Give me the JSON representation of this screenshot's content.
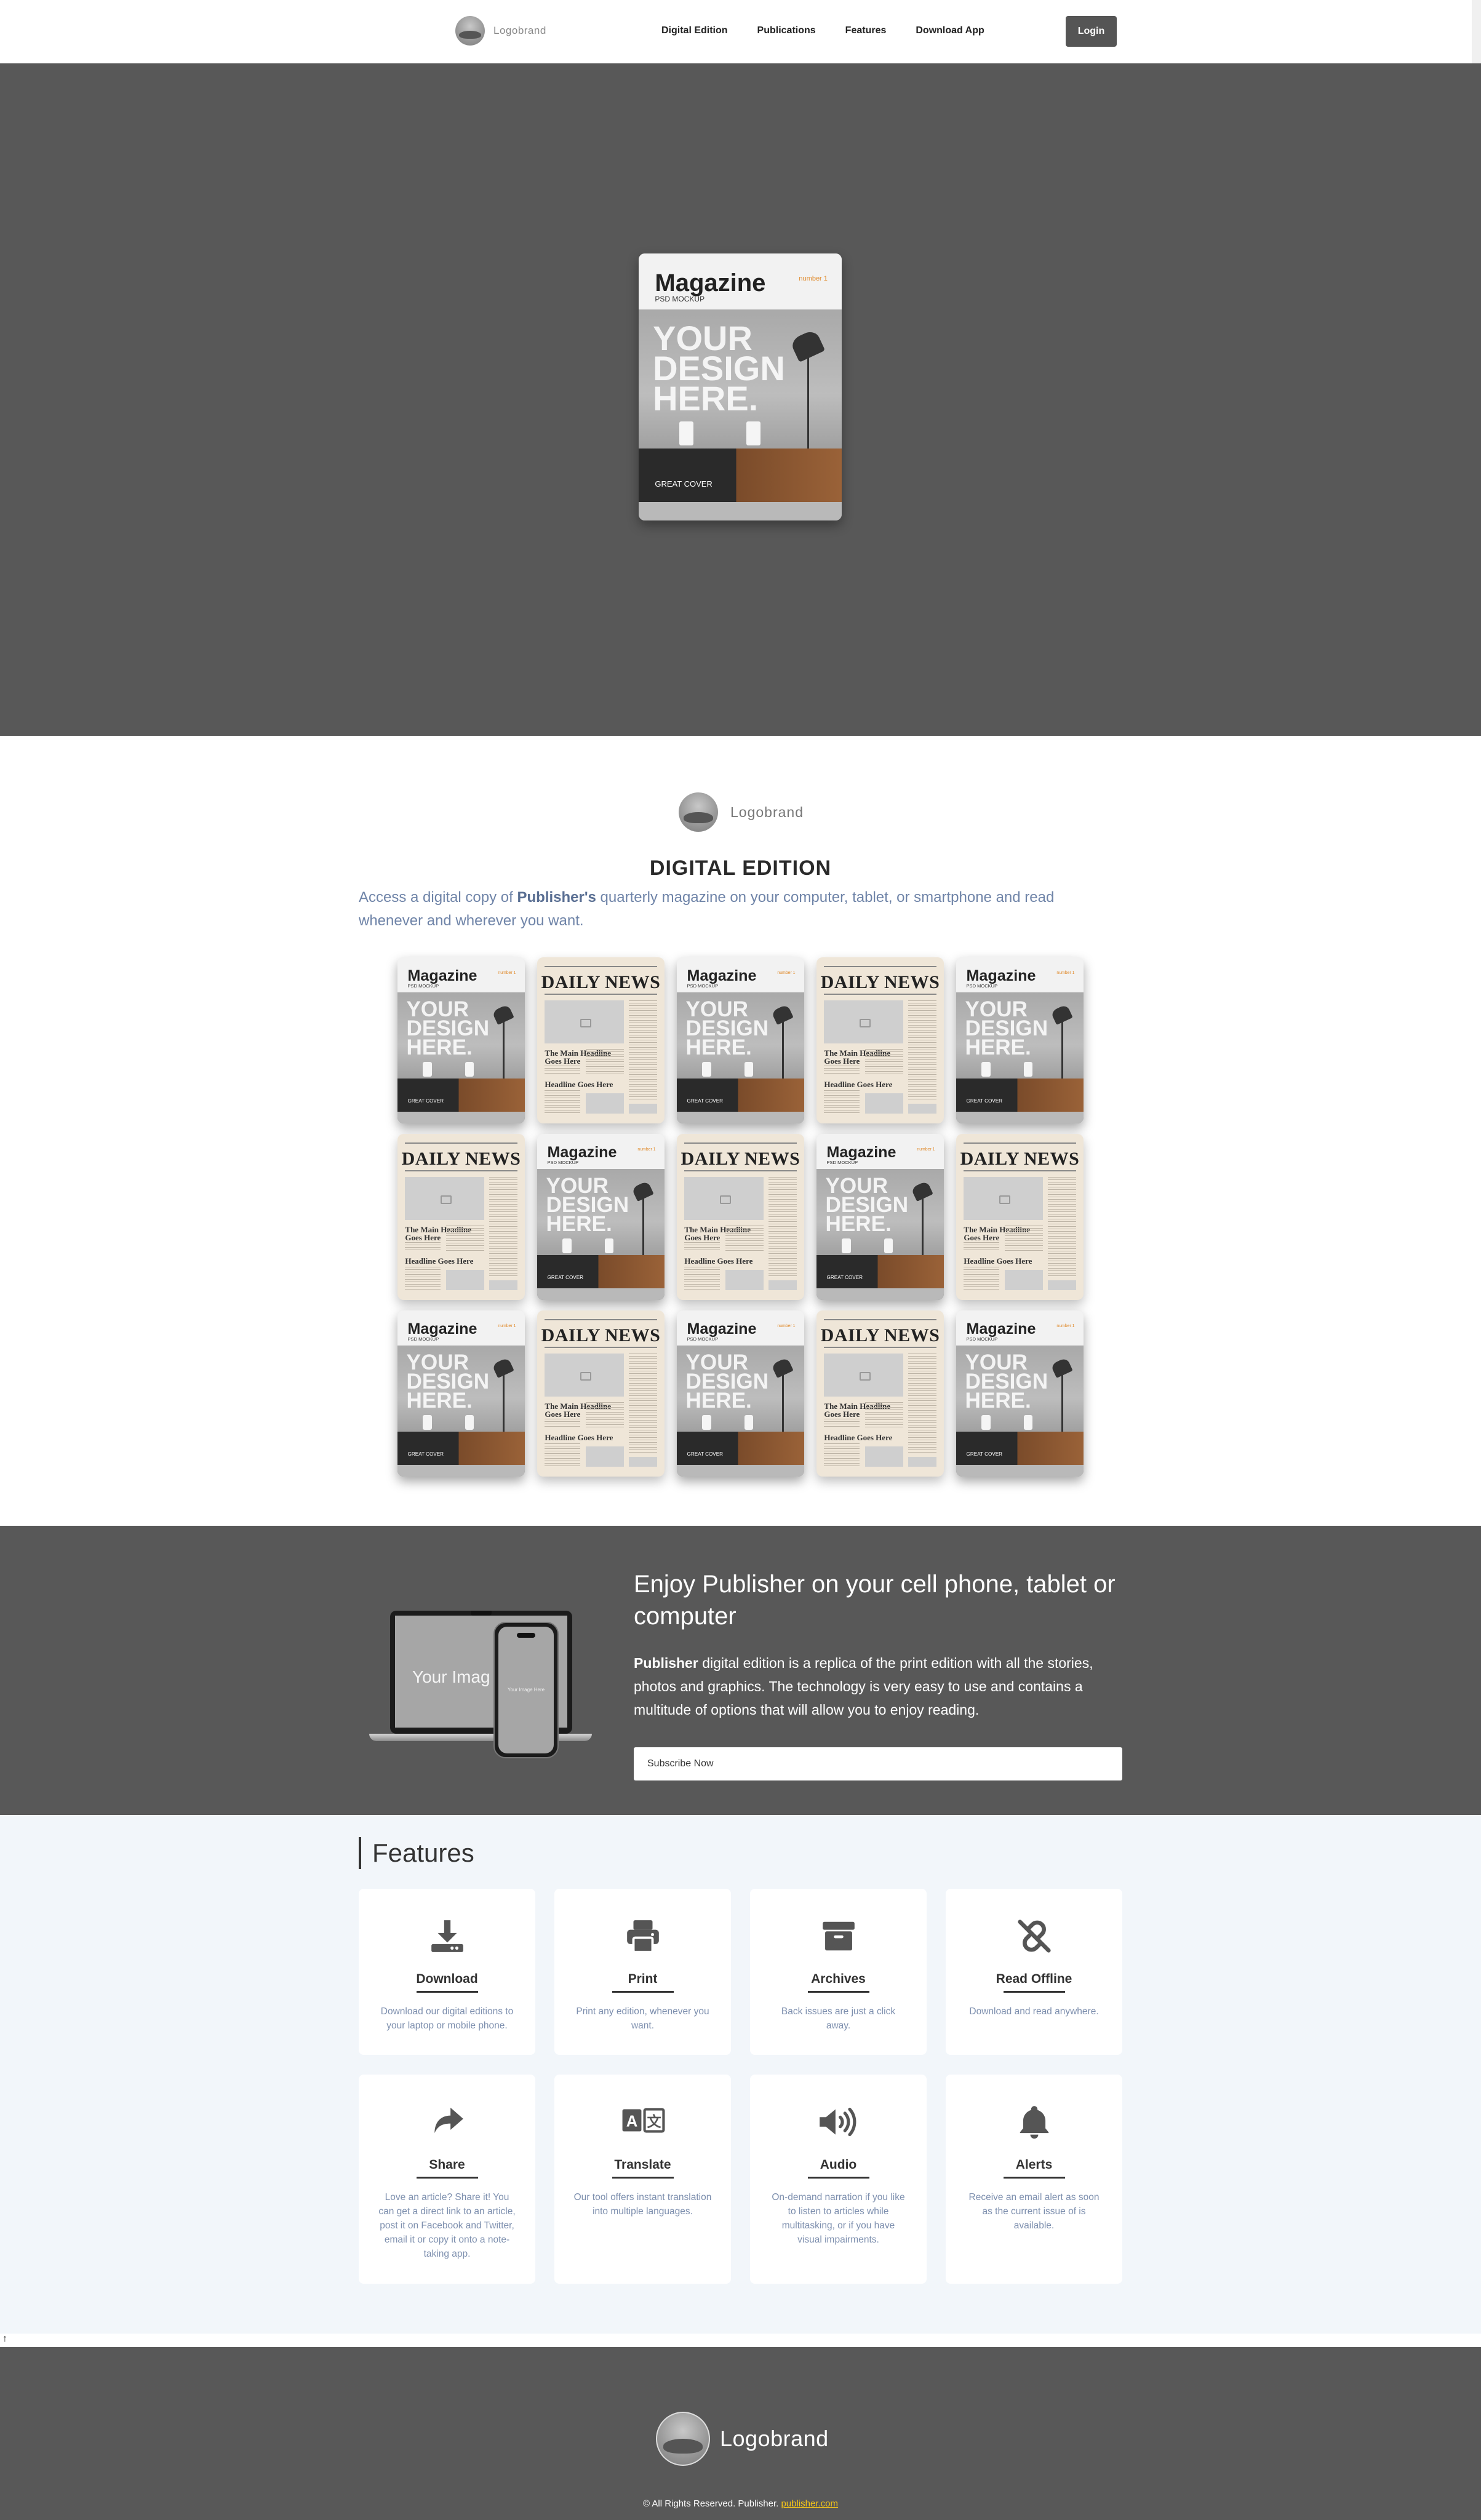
{
  "nav": {
    "logo_text": "Logobrand",
    "links": [
      "Digital Edition",
      "Publications",
      "Features",
      "Download App"
    ],
    "login_label": "Login"
  },
  "magazine": {
    "title": "Magazine",
    "subtitle": "PSD MOCKUP",
    "number": "number 1",
    "big_text": "YOUR DESIGN HERE.",
    "caption": "GREAT COVER"
  },
  "newspaper": {
    "title": "DAILY NEWS",
    "headline1": "The Main Headline Goes Here",
    "headline2": "Headline Goes Here"
  },
  "digital_edition": {
    "logo_text": "Logobrand",
    "title": "DIGITAL EDITION",
    "desc_pre": "Access a digital copy of ",
    "desc_bold": "Publisher's",
    "desc_post": " quarterly magazine on your computer, tablet, or smartphone and read whenever and wherever you want.",
    "grid": [
      [
        "magazine",
        "newspaper",
        "magazine",
        "newspaper",
        "magazine"
      ],
      [
        "newspaper",
        "magazine",
        "newspaper",
        "magazine",
        "newspaper"
      ],
      [
        "magazine",
        "newspaper",
        "magazine",
        "newspaper",
        "magazine"
      ]
    ]
  },
  "app": {
    "laptop_text": "Your Imag",
    "phone_text": "Your Image Here",
    "title": "Enjoy Publisher on your cell phone, tablet or computer",
    "text_bold": "Publisher",
    "text": " digital edition is a replica of the print edition with all the stories, photos and graphics. The technology is very easy to use and contains a multitude of options that will allow you to enjoy reading.",
    "subscribe_label": "Subscribe Now"
  },
  "features": {
    "heading": "Features",
    "items": [
      {
        "icon": "download-icon",
        "title": "Download",
        "desc": "Download our digital editions to your laptop or mobile phone."
      },
      {
        "icon": "print-icon",
        "title": "Print",
        "desc": "Print any edition, whenever you want."
      },
      {
        "icon": "archive-icon",
        "title": "Archives",
        "desc": "Back issues are just a click away."
      },
      {
        "icon": "unlink-icon",
        "title": "Read Offline",
        "desc": "Download and read anywhere."
      },
      {
        "icon": "share-icon",
        "title": "Share",
        "desc": "Love an article? Share it! You can get a direct link to an article, post it on Facebook and Twitter, email it or copy it onto a note-taking app."
      },
      {
        "icon": "translate-icon",
        "title": "Translate",
        "desc": "Our tool offers instant translation into multiple languages."
      },
      {
        "icon": "audio-icon",
        "title": "Audio",
        "desc": "On-demand narration if you like to listen to articles while multitasking, or if you have visual impairments."
      },
      {
        "icon": "bell-icon",
        "title": "Alerts",
        "desc": "Receive an email alert as soon as the current issue of is available."
      }
    ]
  },
  "backtop": "↑",
  "footer": {
    "logo_text": "Logobrand",
    "copyright": "© All Rights Reserved. Publisher. ",
    "link_text": "publisher.com"
  }
}
